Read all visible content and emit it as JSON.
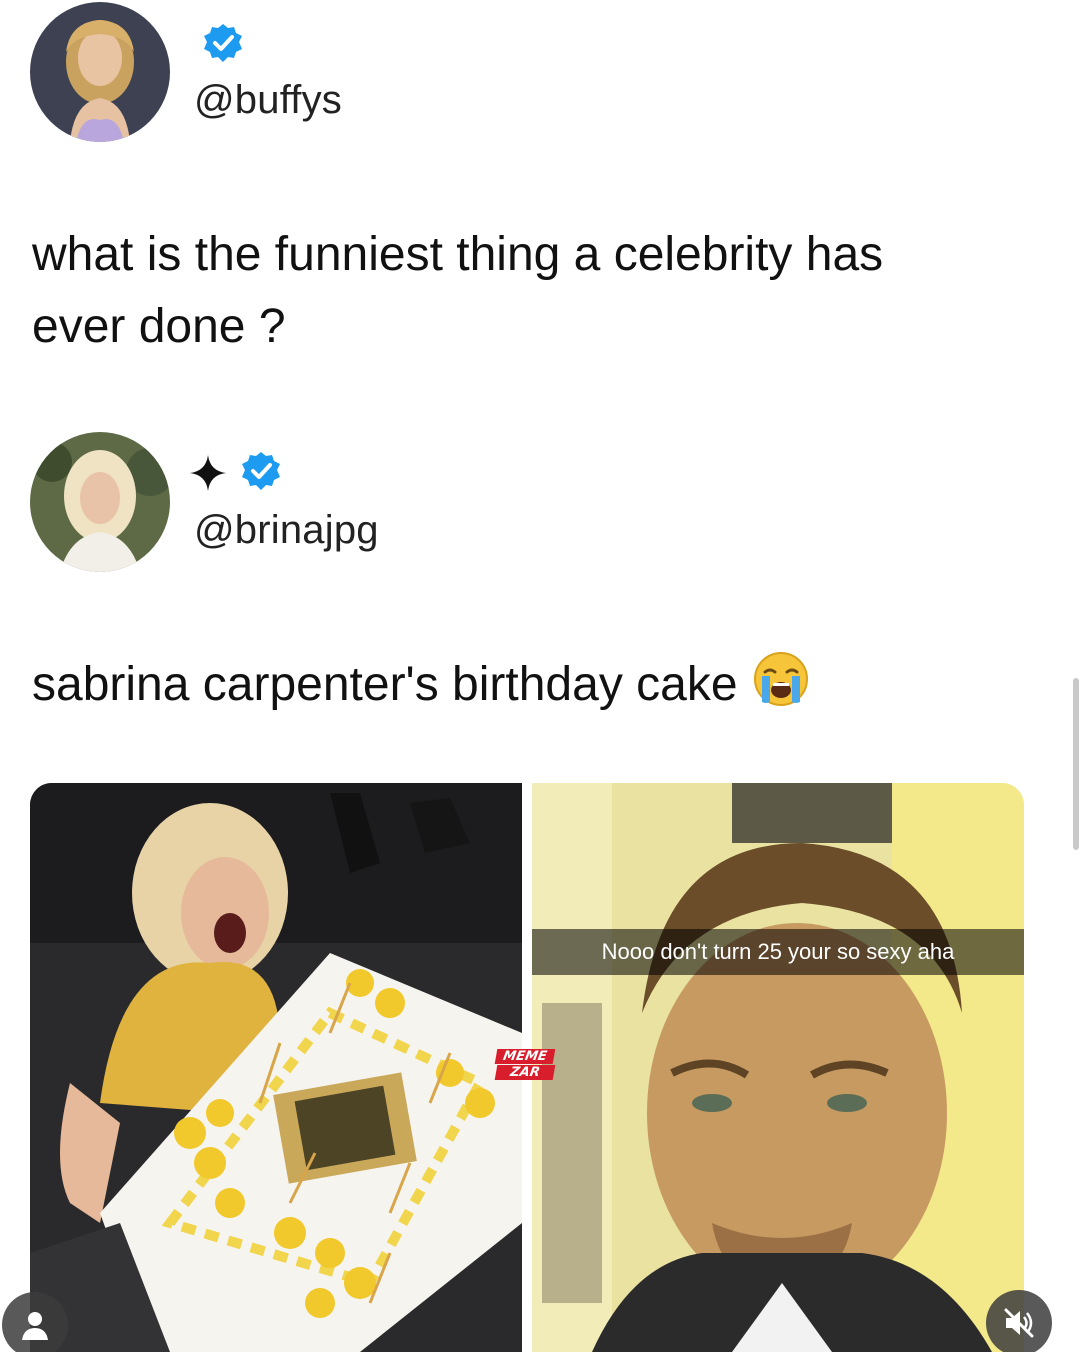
{
  "tweet": {
    "author": {
      "handle": "@buffys",
      "verified": true
    },
    "text_line1": "what is the funniest thing a celebrity has",
    "text_line2": "ever done ?"
  },
  "reply": {
    "author": {
      "handle": "@brinajpg",
      "verified": true,
      "badge_icon": "sparkle-icon"
    },
    "text": "sabrina carpenter's birthday cake",
    "emoji": "loudly-crying-face"
  },
  "media": {
    "left_photo": {
      "description_icon": "birthday-cake-photo"
    },
    "right_photo": {
      "snap_caption": "Nooo don't turn 25 your so sexy aha"
    },
    "watermark": {
      "line1": "MEME",
      "line2": "ZAR"
    }
  },
  "controls": {
    "left_icon": "user-icon",
    "right_icon": "muted-speaker-icon"
  },
  "colors": {
    "verified_blue": "#1d9bf0",
    "text": "#111111",
    "watermark_red": "#d81e2c"
  }
}
